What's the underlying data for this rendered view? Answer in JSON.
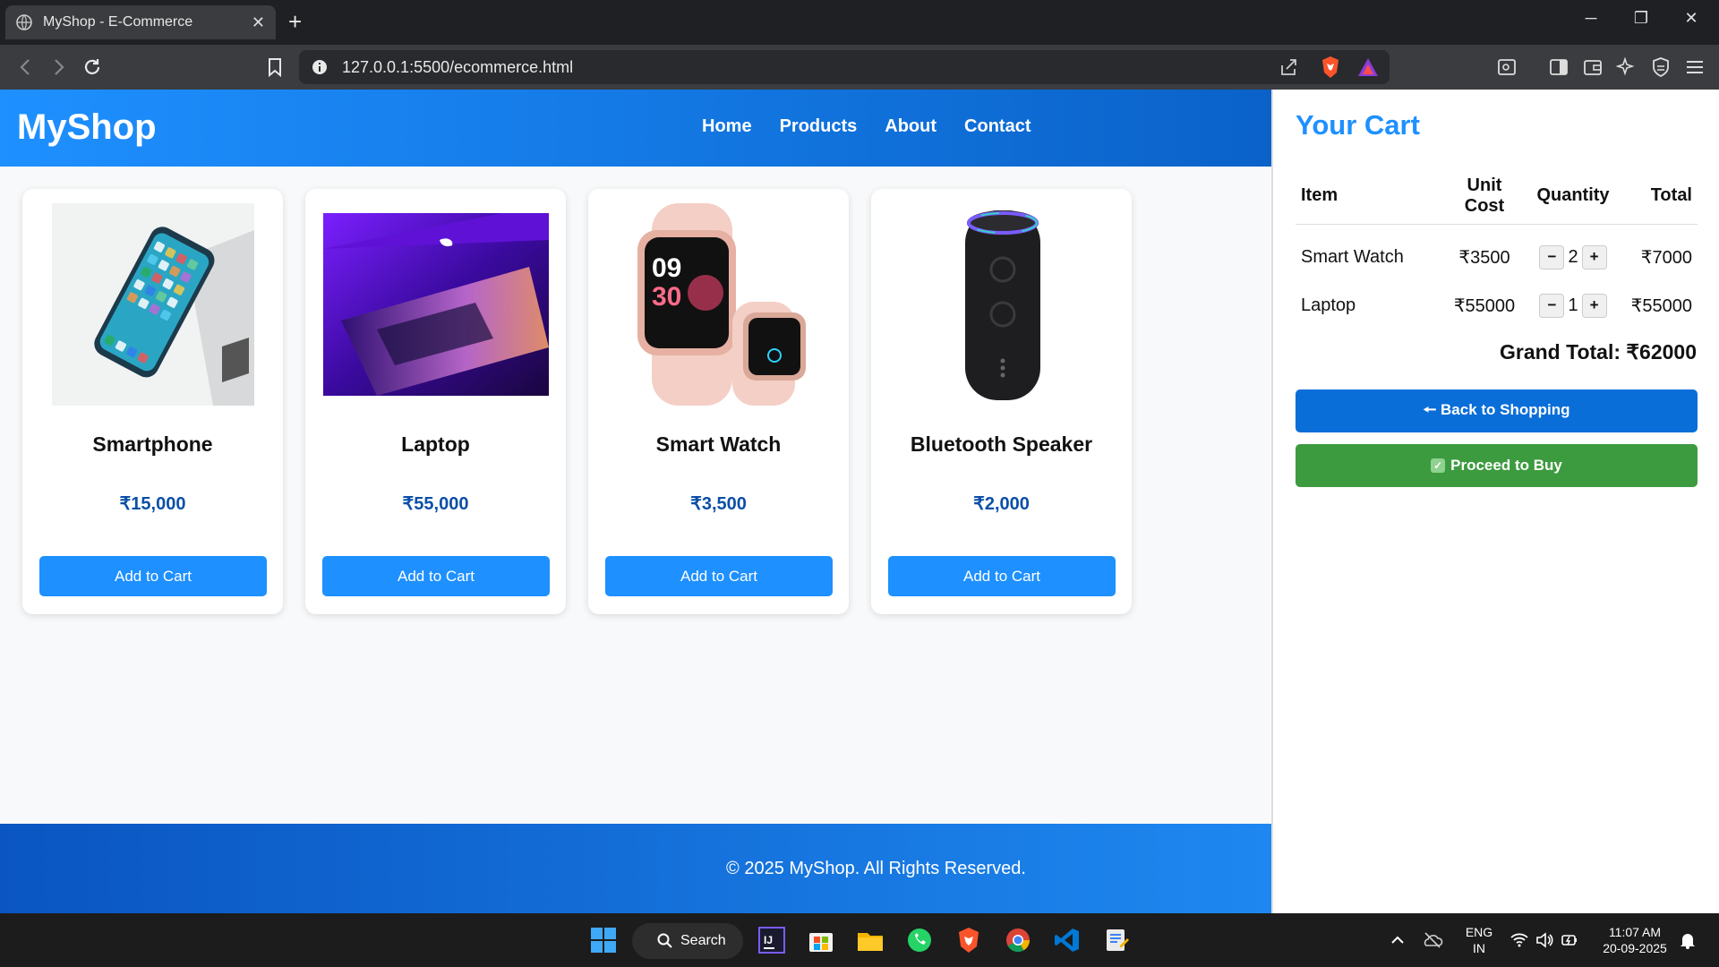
{
  "browser": {
    "tab_title": "MyShop - E-Commerce",
    "tab_close": "✕",
    "new_tab": "+",
    "url": "127.0.0.1:5500/ecommerce.html",
    "window_controls": [
      "─",
      "❐",
      "✕"
    ]
  },
  "site": {
    "logo": "MyShop",
    "nav": [
      "Home",
      "Products",
      "About",
      "Contact"
    ],
    "footer": "© 2025 MyShop. All Rights Reserved."
  },
  "products": [
    {
      "name": "Smartphone",
      "price": "₹15,000",
      "button": "Add to Cart",
      "icon": "smartphone-image"
    },
    {
      "name": "Laptop",
      "price": "₹55,000",
      "button": "Add to Cart",
      "icon": "laptop-image"
    },
    {
      "name": "Smart Watch",
      "price": "₹3,500",
      "button": "Add to Cart",
      "icon": "smartwatch-image"
    },
    {
      "name": "Bluetooth Speaker",
      "price": "₹2,000",
      "button": "Add to Cart",
      "icon": "speaker-image"
    }
  ],
  "cart": {
    "title": "Your Cart",
    "headers": {
      "item": "Item",
      "unit_cost_1": "Unit",
      "unit_cost_2": "Cost",
      "quantity": "Quantity",
      "total": "Total"
    },
    "rows": [
      {
        "item": "Smart Watch",
        "unit_cost": "₹3500",
        "qty": "2",
        "total": "₹7000"
      },
      {
        "item": "Laptop",
        "unit_cost": "₹55000",
        "qty": "1",
        "total": "₹55000"
      }
    ],
    "minus": "−",
    "plus": "+",
    "grand_total": "Grand Total: ₹62000",
    "back_label": "🠔 Back to Shopping",
    "buy_label": "Proceed to Buy",
    "buy_check": "✓"
  },
  "taskbar": {
    "search": "Search",
    "lang_1": "ENG",
    "lang_2": "IN",
    "time": "11:07 AM",
    "date": "20-09-2025"
  },
  "colors": {
    "brand": "#1e90ff",
    "buy": "#3d9b3f",
    "price": "#0b4fa8"
  }
}
